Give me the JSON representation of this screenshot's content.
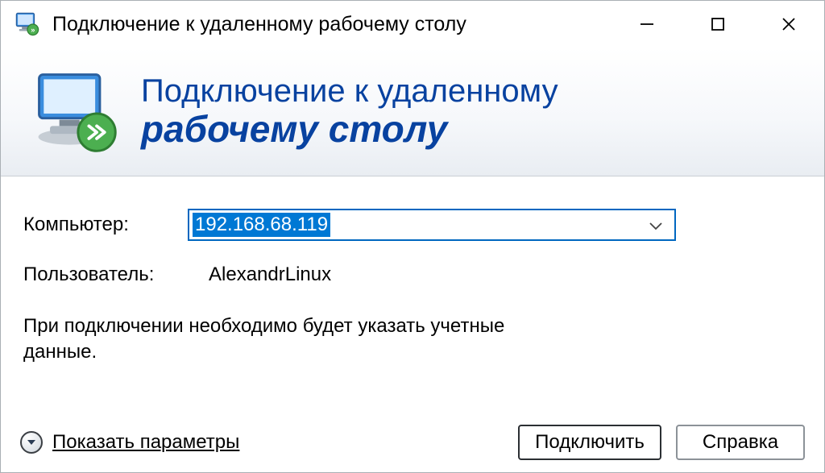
{
  "titlebar": {
    "title": "Подключение к удаленному рабочему столу"
  },
  "banner": {
    "line1": "Подключение к удаленному",
    "line2": "рабочему столу"
  },
  "form": {
    "computer_label": "Компьютер:",
    "computer_value": "192.168.68.119",
    "user_label": "Пользователь:",
    "user_value": "AlexandrLinux",
    "info_text": "При подключении необходимо будет указать учетные данные."
  },
  "footer": {
    "toggle_label": "Показать параметры",
    "connect_label": "Подключить",
    "help_label": "Справка"
  },
  "icons": {
    "app": "rdp-icon",
    "minimize": "minimize-icon",
    "maximize": "maximize-icon",
    "close": "close-icon",
    "dropdown": "chevron-down-icon",
    "expand": "chevron-down-circle-icon"
  }
}
